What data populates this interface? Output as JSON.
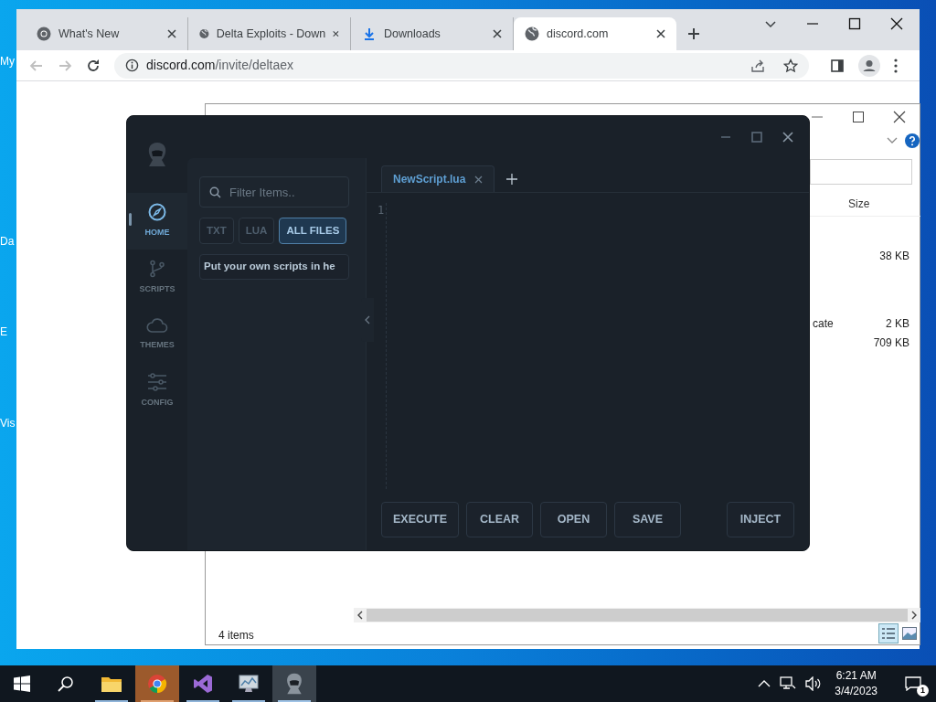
{
  "desktop_icons": [
    {
      "label": "My"
    },
    {
      "label": "Da"
    },
    {
      "label": "E"
    },
    {
      "label": "Vis"
    }
  ],
  "browser": {
    "tabs": [
      {
        "title": "What's New",
        "kind": "chrome",
        "selected": false
      },
      {
        "title": "Delta Exploits - Down",
        "kind": "globe",
        "selected": false
      },
      {
        "title": "Downloads",
        "kind": "download",
        "selected": false
      },
      {
        "title": "discord.com",
        "kind": "globe",
        "selected": true
      }
    ],
    "url_host": "discord.com",
    "url_path": "/invite/deltaex"
  },
  "explorer": {
    "column": "Size",
    "rows": [
      {
        "size": "38 KB"
      },
      {
        "column_1": "cate",
        "size": "2 KB"
      },
      {
        "size": "709 KB"
      }
    ],
    "status": "4 items"
  },
  "delta": {
    "nav": [
      {
        "label": "HOME",
        "kind": "compass",
        "selected": true
      },
      {
        "label": "SCRIPTS",
        "kind": "branch",
        "selected": false
      },
      {
        "label": "THEMES",
        "kind": "cloud",
        "selected": false
      },
      {
        "label": "CONFIG",
        "kind": "sliders",
        "selected": false
      }
    ],
    "search": {
      "placeholder": "Filter Items.."
    },
    "filters": [
      {
        "label": "TXT",
        "selected": false
      },
      {
        "label": "LUA",
        "selected": false
      },
      {
        "label": "ALL FILES",
        "selected": true
      }
    ],
    "scripts": [
      "Put your own scripts in he"
    ],
    "editor_tabs": [
      {
        "label": "NewScript.lua",
        "selected": true
      }
    ],
    "line_numbers": [
      "1"
    ],
    "actions": [
      "EXECUTE",
      "CLEAR",
      "OPEN",
      "SAVE"
    ],
    "inject": "INJECT"
  },
  "taskbar": {
    "apps": [
      {
        "kind": "folder",
        "flashing": false,
        "selected": false
      },
      {
        "kind": "chrome",
        "flashing": true,
        "selected": false
      },
      {
        "kind": "studio",
        "flashing": false,
        "selected": false
      },
      {
        "kind": "monitor",
        "flashing": false,
        "selected": false
      },
      {
        "kind": "delta",
        "flashing": false,
        "selected": true
      }
    ],
    "time": "6:21 AM",
    "date": "3/4/2023",
    "notifications": "1"
  }
}
